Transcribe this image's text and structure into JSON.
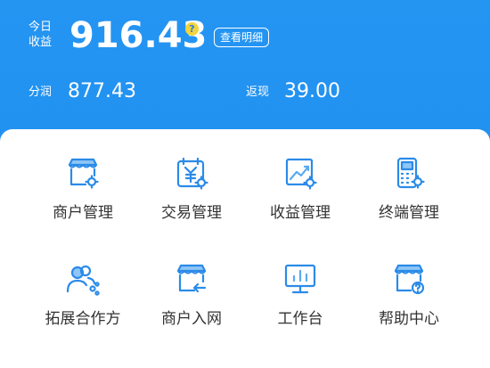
{
  "earnings": {
    "today_label": "今日收益",
    "today_value": "916.43",
    "help_icon": "question-icon",
    "detail_button": "查看明细"
  },
  "stats": {
    "profit_label": "分润",
    "profit_value": "877.43",
    "rebate_label": "返现",
    "rebate_value": "39.00"
  },
  "menu": {
    "items": [
      {
        "label": "商户管理",
        "icon": "merchant-store-icon"
      },
      {
        "label": "交易管理",
        "icon": "transaction-calendar-icon"
      },
      {
        "label": "收益管理",
        "icon": "earnings-chart-icon"
      },
      {
        "label": "终端管理",
        "icon": "pos-terminal-icon"
      },
      {
        "label": "拓展合作方",
        "icon": "partners-icon"
      },
      {
        "label": "商户入网",
        "icon": "merchant-onboard-icon"
      },
      {
        "label": "工作台",
        "icon": "workbench-monitor-icon"
      },
      {
        "label": "帮助中心",
        "icon": "help-center-icon"
      }
    ]
  },
  "colors": {
    "header_blue": "#1e8ff0",
    "icon_blue": "#2b8be8",
    "help_yellow": "#f3d43a"
  }
}
